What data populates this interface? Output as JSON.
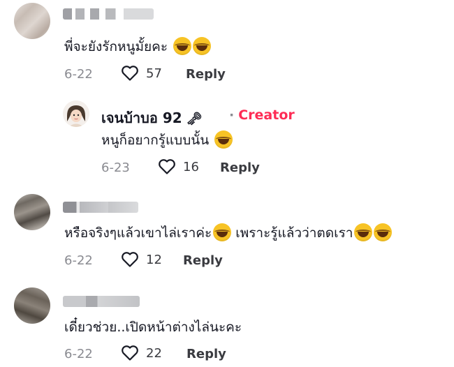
{
  "comments": [
    {
      "text": "พี่จะยังรักหนูมั้ยคะ",
      "date": "6-22",
      "likes": "57",
      "reply": "Reply"
    },
    {
      "author": "เจนบ้าบอ 92",
      "badge": "Creator",
      "text": "หนูก็อยากรู้แบบนั้น",
      "date": "6-23",
      "likes": "16",
      "reply": "Reply"
    },
    {
      "text_part1": "หรือจริงๆแล้วเขาไล่เราค่ะ",
      "text_part2": "เพราะรู้แล้วว่าตดเรา",
      "date": "6-22",
      "likes": "12",
      "reply": "Reply"
    },
    {
      "text": "เดี๋ยวช่วย..เปิดหน้าต่างไล่นะคะ",
      "date": "6-22",
      "likes": "22",
      "reply": "Reply"
    }
  ],
  "colors": {
    "creator_badge": "#fe2c55",
    "meta_gray": "#8a8b91",
    "emoji": "tears-of-joy"
  }
}
